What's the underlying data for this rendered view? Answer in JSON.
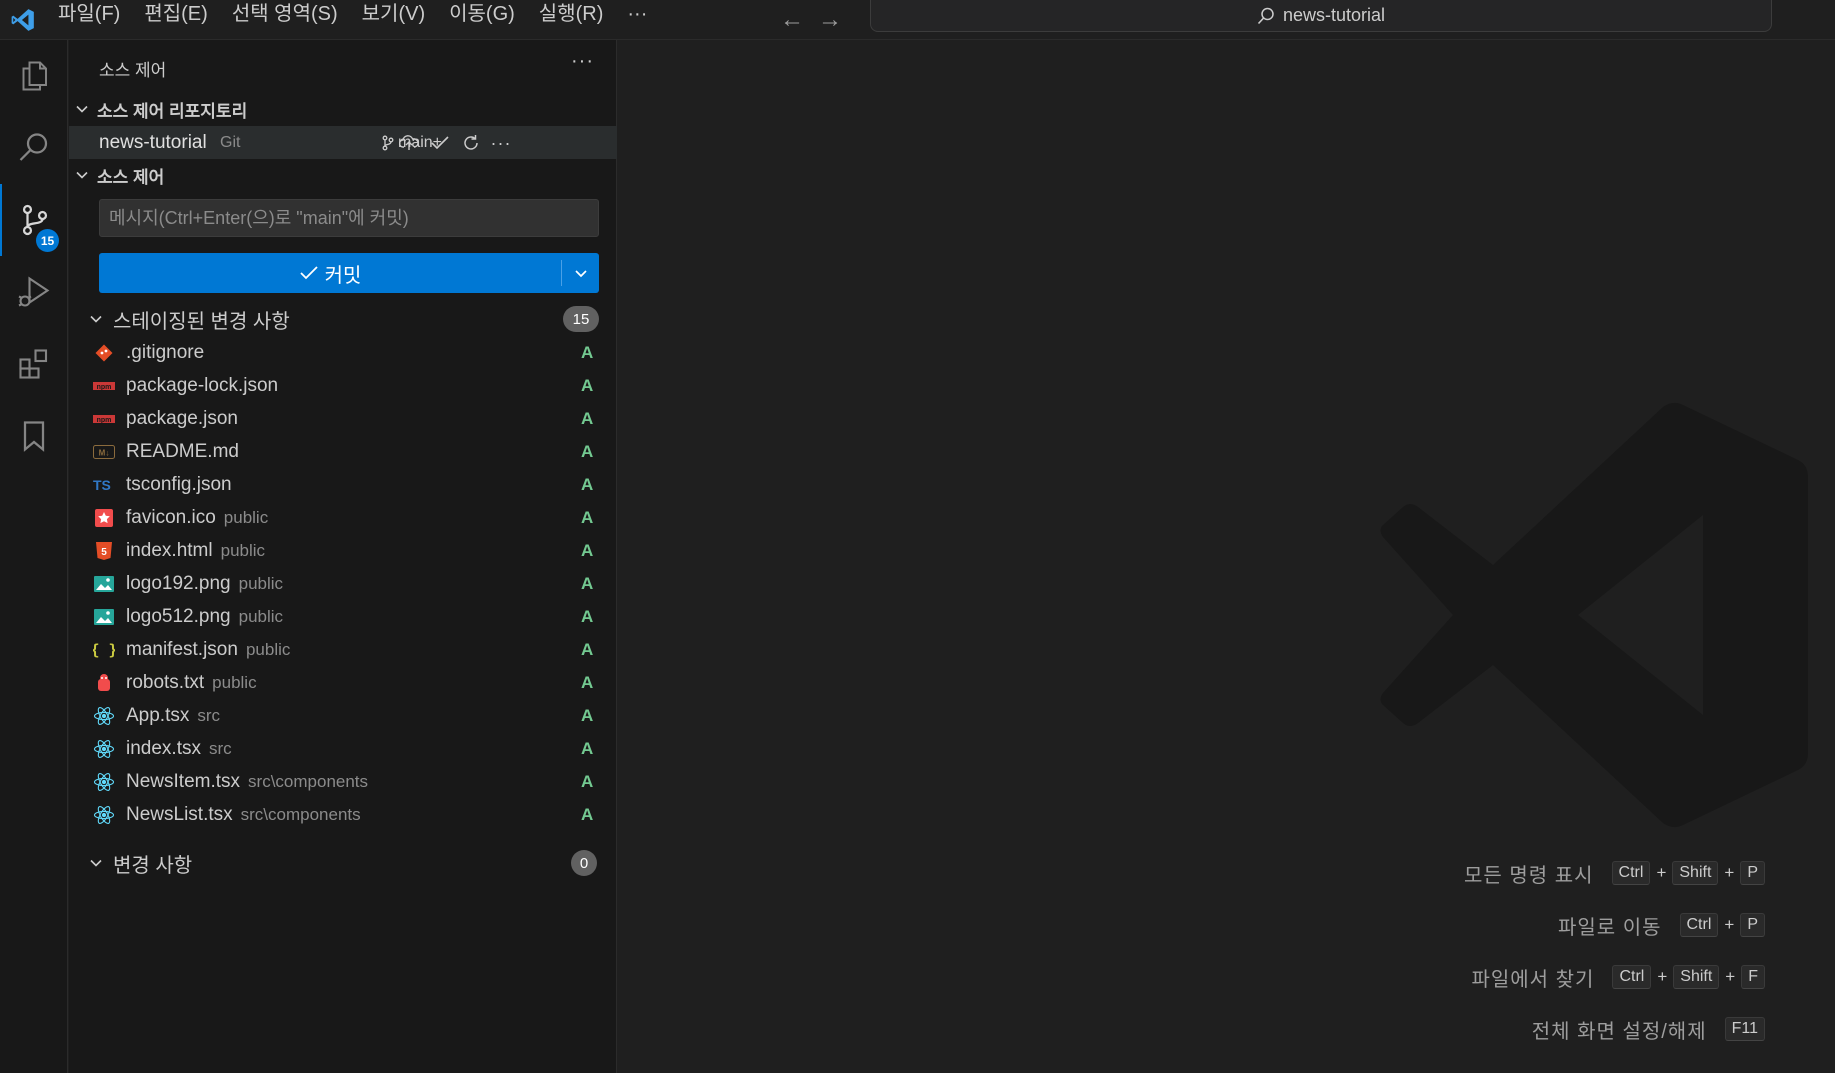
{
  "menu": [
    "파일(F)",
    "편집(E)",
    "선택 영역(S)",
    "보기(V)",
    "이동(G)",
    "실행(R)",
    "···"
  ],
  "search": {
    "text": "news-tutorial"
  },
  "activity": {
    "scm_badge": "15"
  },
  "sidebar": {
    "title": "소스 제어",
    "more": "···",
    "repos_header": "소스 제어 리포지토리",
    "repo": {
      "name": "news-tutorial",
      "type": "Git",
      "branch": "main+"
    },
    "scm_header": "소스 제어",
    "message_placeholder": "메시지(Ctrl+Enter(으)로 \"main\"에 커밋)",
    "commit_label": "커밋",
    "staged": {
      "label": "스테이징된 변경 사항",
      "count": "15",
      "files": [
        {
          "name": ".gitignore",
          "dir": "",
          "status": "A",
          "icon": "git-icon",
          "color": "#e44d26"
        },
        {
          "name": "package-lock.json",
          "dir": "",
          "status": "A",
          "icon": "npm-icon",
          "color": "#cb3837"
        },
        {
          "name": "package.json",
          "dir": "",
          "status": "A",
          "icon": "npm-icon",
          "color": "#cb3837"
        },
        {
          "name": "README.md",
          "dir": "",
          "status": "A",
          "icon": "markdown-icon",
          "color": "#8b6b3d"
        },
        {
          "name": "tsconfig.json",
          "dir": "",
          "status": "A",
          "icon": "typescript-icon",
          "color": "#3178c6"
        },
        {
          "name": "favicon.ico",
          "dir": "public",
          "status": "A",
          "icon": "favicon-icon",
          "color": "#f14c4c"
        },
        {
          "name": "index.html",
          "dir": "public",
          "status": "A",
          "icon": "html-icon",
          "color": "#e44d26"
        },
        {
          "name": "logo192.png",
          "dir": "public",
          "status": "A",
          "icon": "image-icon",
          "color": "#26a69a"
        },
        {
          "name": "logo512.png",
          "dir": "public",
          "status": "A",
          "icon": "image-icon",
          "color": "#26a69a"
        },
        {
          "name": "manifest.json",
          "dir": "public",
          "status": "A",
          "icon": "json-icon",
          "color": "#cbcb41"
        },
        {
          "name": "robots.txt",
          "dir": "public",
          "status": "A",
          "icon": "robot-icon",
          "color": "#f14c4c"
        },
        {
          "name": "App.tsx",
          "dir": "src",
          "status": "A",
          "icon": "react-icon",
          "color": "#61dafb"
        },
        {
          "name": "index.tsx",
          "dir": "src",
          "status": "A",
          "icon": "react-icon",
          "color": "#61dafb"
        },
        {
          "name": "NewsItem.tsx",
          "dir": "src\\components",
          "status": "A",
          "icon": "react-icon",
          "color": "#61dafb"
        },
        {
          "name": "NewsList.tsx",
          "dir": "src\\components",
          "status": "A",
          "icon": "react-icon",
          "color": "#61dafb"
        }
      ]
    },
    "changes": {
      "label": "변경 사항",
      "count": "0"
    }
  },
  "shortcuts": [
    {
      "label": "모든 명령 표시",
      "keys": [
        "Ctrl",
        "Shift",
        "P"
      ]
    },
    {
      "label": "파일로 이동",
      "keys": [
        "Ctrl",
        "P"
      ]
    },
    {
      "label": "파일에서 찾기",
      "keys": [
        "Ctrl",
        "Shift",
        "F"
      ]
    },
    {
      "label": "전체 화면 설정/해제",
      "keys": [
        "F11"
      ]
    }
  ]
}
